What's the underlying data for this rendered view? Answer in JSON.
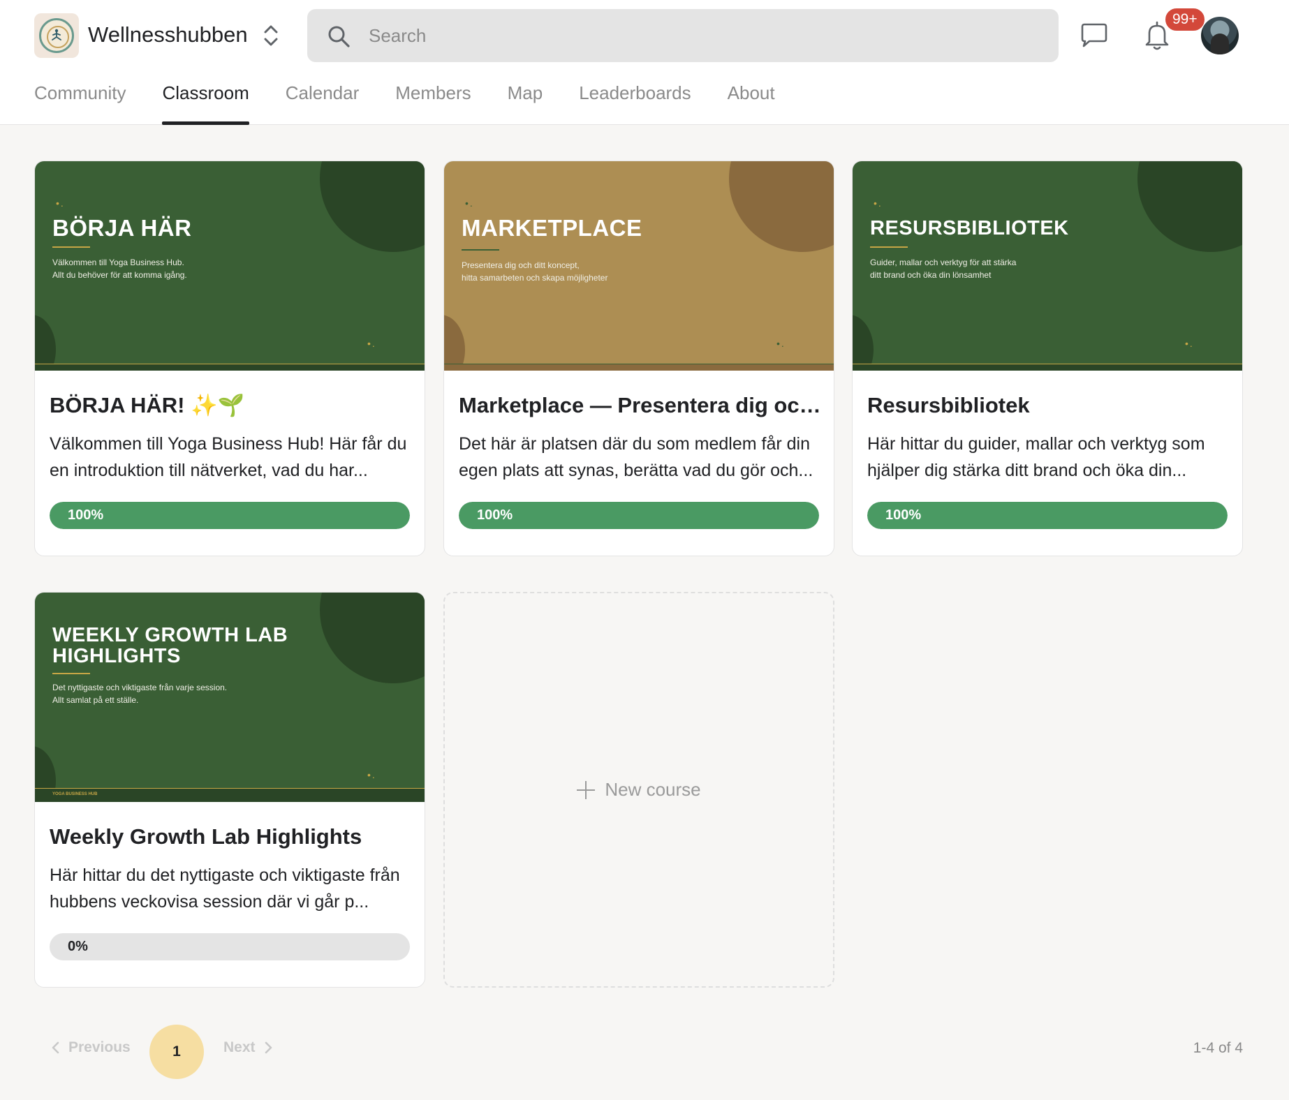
{
  "app": {
    "name": "Wellnesshubben",
    "search_placeholder": "Search",
    "notifications_badge": "99+"
  },
  "tabs": [
    {
      "label": "Community",
      "active": false
    },
    {
      "label": "Classroom",
      "active": true
    },
    {
      "label": "Calendar",
      "active": false
    },
    {
      "label": "Members",
      "active": false
    },
    {
      "label": "Map",
      "active": false
    },
    {
      "label": "Leaderboards",
      "active": false
    },
    {
      "label": "About",
      "active": false
    }
  ],
  "courses": [
    {
      "cover_title": "BÖRJA HÄR",
      "cover_subtitle": "Välkommen till Yoga Business Hub.\nAllt du behöver för att komma igång.",
      "title": "BÖRJA HÄR! ✨🌱",
      "description": "Välkommen till Yoga Business Hub! Här får du en introduktion till nätverket, vad du har...",
      "progress_label": "100%",
      "progress": 1.0,
      "theme": {
        "bg": "#3a5f35",
        "accent": "#c7a646",
        "circle": "#2a4526"
      }
    },
    {
      "cover_title": "MARKETPLACE",
      "cover_subtitle": "Presentera dig och ditt koncept,\nhitta samarbeten och skapa möjligheter",
      "title": "Marketplace — Presentera dig och...",
      "description": "Det här är platsen där du som medlem får din egen plats att synas, berätta vad du gör och...",
      "progress_label": "100%",
      "progress": 1.0,
      "theme": {
        "bg": "#ad8e53",
        "accent": "#3a5f35",
        "circle": "#8a6a3e"
      }
    },
    {
      "cover_title": "RESURSBIBLIOTEK",
      "cover_subtitle": "Guider, mallar och verktyg för att stärka\nditt brand och öka din lönsamhet",
      "title": "Resursbibliotek",
      "description": "Här hittar du guider, mallar och verktyg som hjälper dig stärka ditt brand och öka din...",
      "progress_label": "100%",
      "progress": 1.0,
      "theme": {
        "bg": "#3a5f35",
        "accent": "#c7a646",
        "circle": "#2a4526"
      }
    },
    {
      "cover_title": "WEEKLY GROWTH LAB\nHIGHLIGHTS",
      "cover_subtitle": "Det nyttigaste och viktigaste från varje session.\nAllt samlat på ett ställe.",
      "cover_footer_left": "YOGA BUSINESS HUB",
      "title": "Weekly Growth Lab Highlights",
      "description": "Här hittar du det nyttigaste och viktigaste från hubbens veckovisa session där vi går p...",
      "progress_label": "0%",
      "progress": 0.0,
      "theme": {
        "bg": "#3a5f35",
        "accent": "#c7a646",
        "circle": "#2a4526"
      }
    }
  ],
  "new_course_label": "New course",
  "pagination": {
    "previous_label": "Previous",
    "current_page": "1",
    "next_label": "Next",
    "range_label": "1-4 of 4"
  },
  "colors": {
    "progress_fill": "#4a9a63",
    "badge": "#d3483a",
    "page_active": "#f6dea2"
  }
}
